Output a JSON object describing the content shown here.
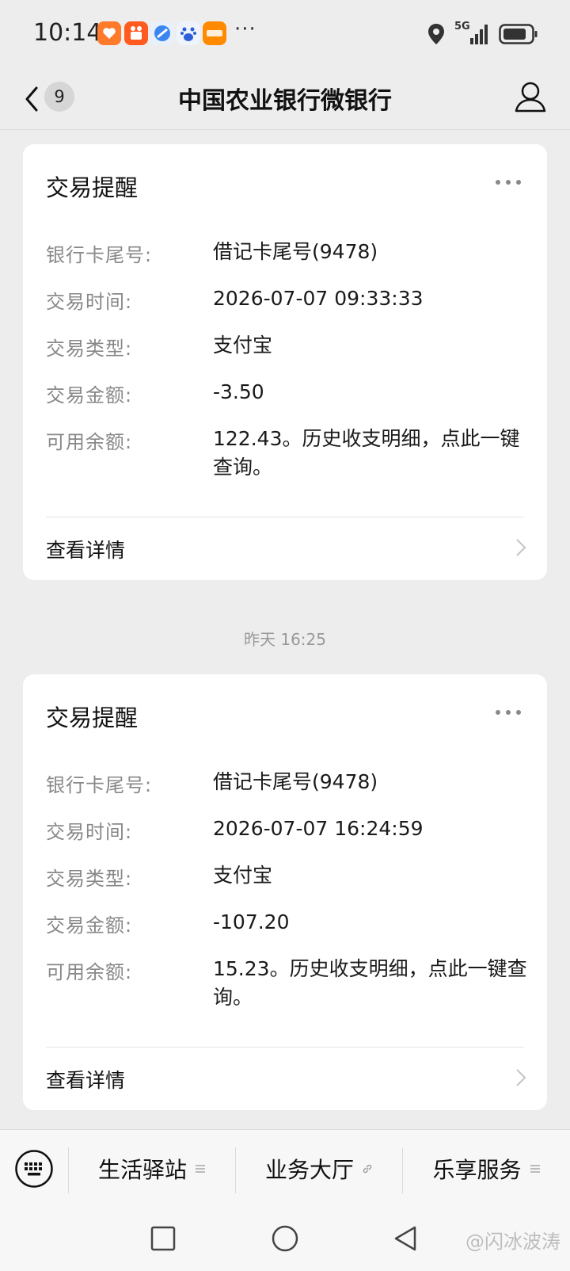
{
  "status_bar": {
    "time": "10:14",
    "more_dots": "···",
    "network": "5G",
    "apps": [
      "heart-app-icon",
      "kuaishou-app-icon",
      "browser-app-icon",
      "baidu-app-icon",
      "app-store-icon"
    ]
  },
  "header": {
    "title": "中国农业银行微银行",
    "unread_count": "9"
  },
  "labels": {
    "card_tail": "银行卡尾号:",
    "time": "交易时间:",
    "type": "交易类型:",
    "amount": "交易金额:",
    "balance": "可用余额:"
  },
  "cards": [
    {
      "title": "交易提醒",
      "card_tail": "借记卡尾号(9478)",
      "time": "2026-07-07 09:33:33",
      "type": "支付宝",
      "amount": "-3.50",
      "balance": "122.43。历史收支明细，点此一键查询。",
      "details": "查看详情"
    },
    {
      "title": "交易提醒",
      "card_tail": "借记卡尾号(9478)",
      "time": "2026-07-07 16:24:59",
      "type": "支付宝",
      "amount": "-107.20",
      "balance": "15.23。历史收支明细，点此一键查询。",
      "details": "查看详情"
    }
  ],
  "timestamp": "昨天 16:25",
  "bottom_menu": {
    "items": [
      "生活驿站",
      "业务大厅",
      "乐享服务"
    ]
  },
  "watermark": "@闪冰波涛",
  "colors": {
    "background": "#ededed",
    "card": "#ffffff",
    "label_gray": "#888888"
  }
}
